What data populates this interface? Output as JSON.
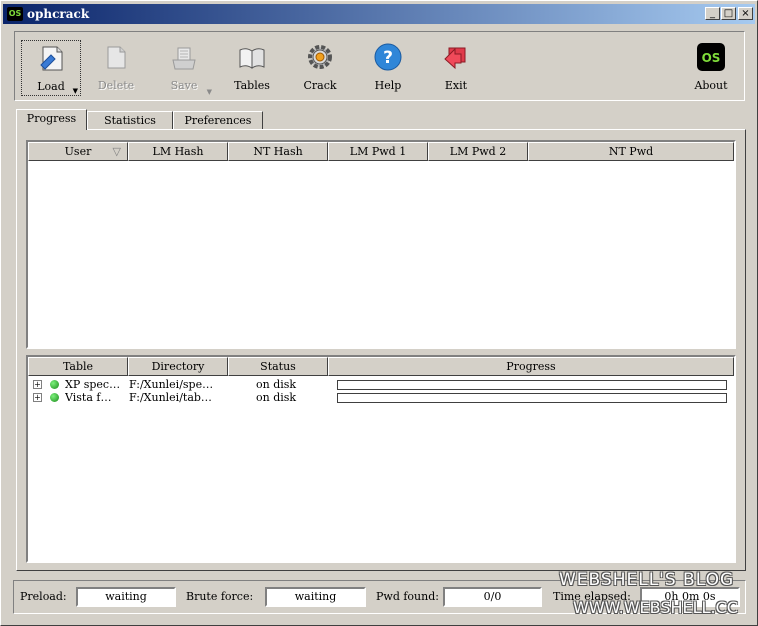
{
  "app": {
    "title": "ophcrack",
    "icon_text": "OS",
    "controls": {
      "minimize": "_",
      "maximize": "□",
      "close": "×"
    }
  },
  "toolbar": {
    "load": "Load",
    "delete": "Delete",
    "save": "Save",
    "tables": "Tables",
    "crack": "Crack",
    "help": "Help",
    "exit": "Exit",
    "about": "About",
    "about_icon_text": "OS",
    "help_icon_text": "?"
  },
  "tabs": {
    "progress": "Progress",
    "statistics": "Statistics",
    "preferences": "Preferences"
  },
  "hash_table": {
    "columns": [
      "User",
      "LM Hash",
      "NT Hash",
      "LM Pwd 1",
      "LM Pwd 2",
      "NT Pwd"
    ],
    "rows": []
  },
  "tables_list": {
    "columns": [
      "Table",
      "Directory",
      "Status",
      "Progress"
    ],
    "rows": [
      {
        "table": "XP spec…",
        "directory": "F:/Xunlei/spe…",
        "status": "on disk",
        "progress": 0,
        "expander": "+"
      },
      {
        "table": "Vista f…",
        "directory": "F:/Xunlei/tab…",
        "status": "on disk",
        "progress": 0,
        "expander": "+"
      }
    ]
  },
  "statusbar": {
    "preload_label": "Preload:",
    "preload_value": "waiting",
    "brute_label": "Brute force:",
    "brute_value": "waiting",
    "pwd_label": "Pwd found:",
    "pwd_value": "0/0",
    "time_label": "Time elapsed:",
    "time_value": "0h 0m 0s"
  },
  "watermark": {
    "line1": "WEBSHELL'S BLOG",
    "line2": "WWW.WEBSHELL.CC"
  },
  "colors": {
    "face": "#d4d0c8",
    "title_start": "#0a246a",
    "title_end": "#a6caf0",
    "status_dot": "#1a8a1a"
  },
  "icons": {
    "load": "document-icon",
    "delete": "document-icon",
    "save": "scanner-icon",
    "tables": "book-icon",
    "crack": "gear-icon",
    "help": "help-icon",
    "exit": "exit-icon",
    "about": "about-logo-icon"
  }
}
